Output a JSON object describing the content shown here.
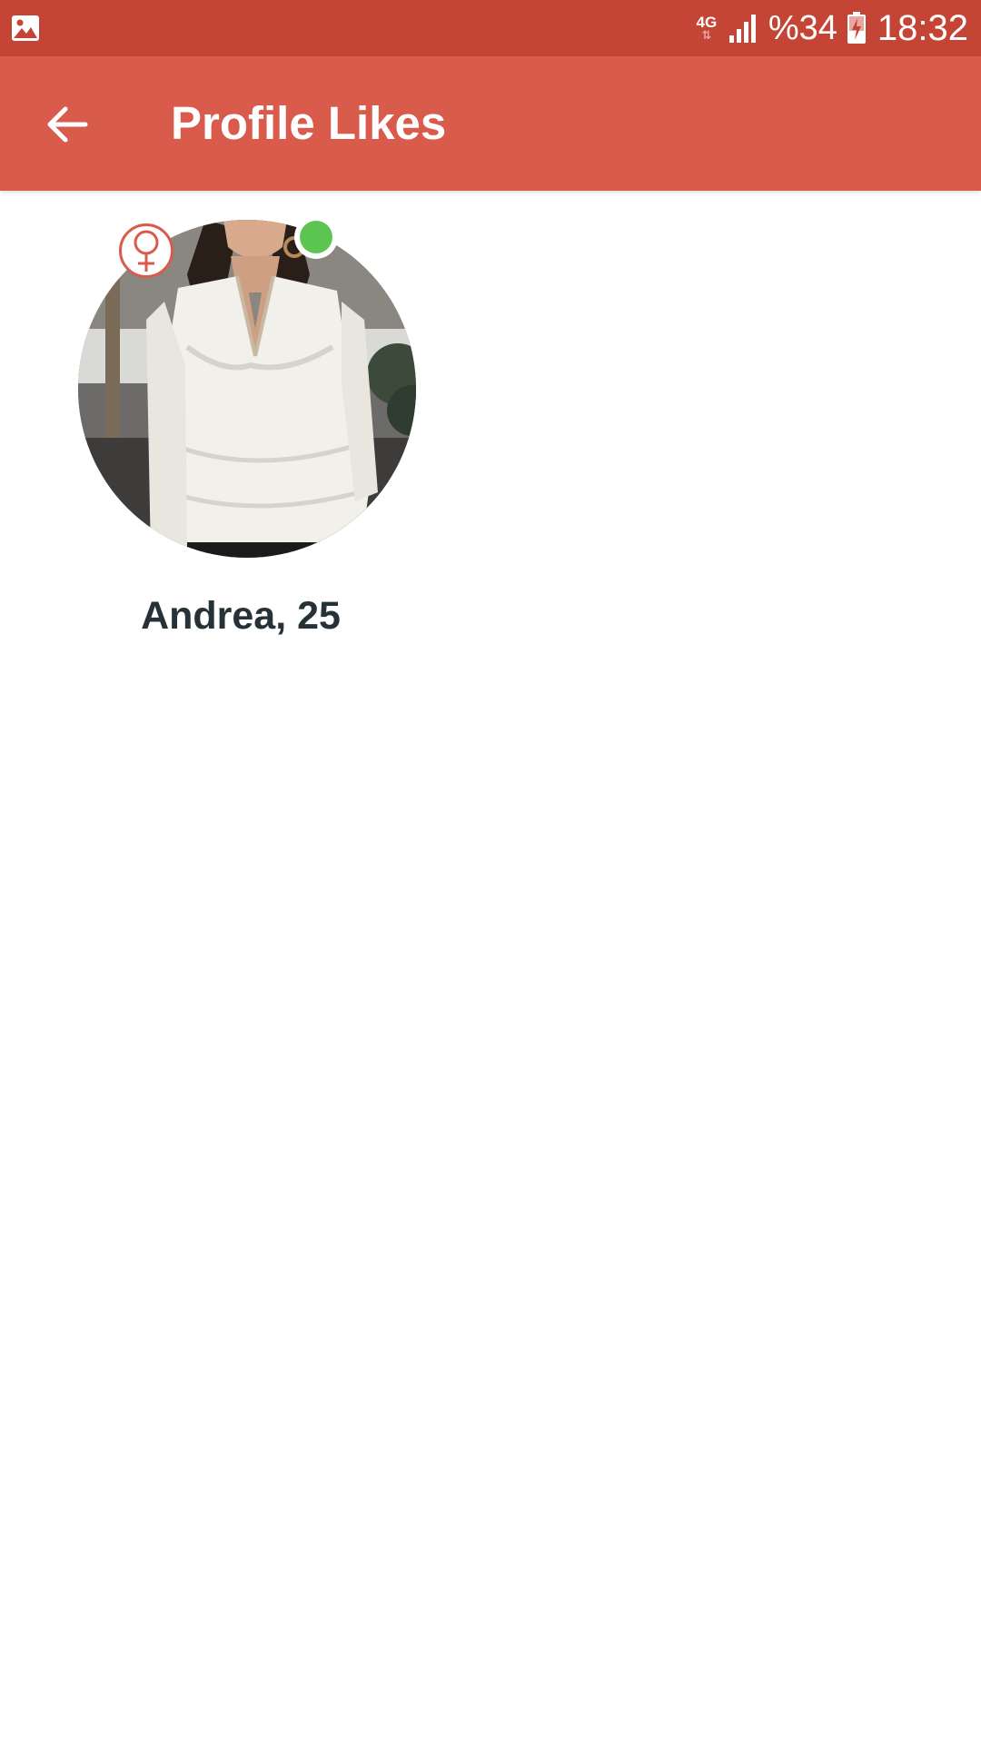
{
  "status_bar": {
    "network_type": "4G",
    "network_arrows": "⇅",
    "battery": "%34",
    "time": "18:32",
    "background_color": "#c44536"
  },
  "app_bar": {
    "title": "Profile Likes",
    "back_icon": "arrow-left-icon",
    "background_color": "#d95b4c"
  },
  "profiles": [
    {
      "name_age": "Andrea, 25",
      "gender_icon": "female-symbol-icon",
      "online": true,
      "online_color": "#5cc552"
    }
  ]
}
